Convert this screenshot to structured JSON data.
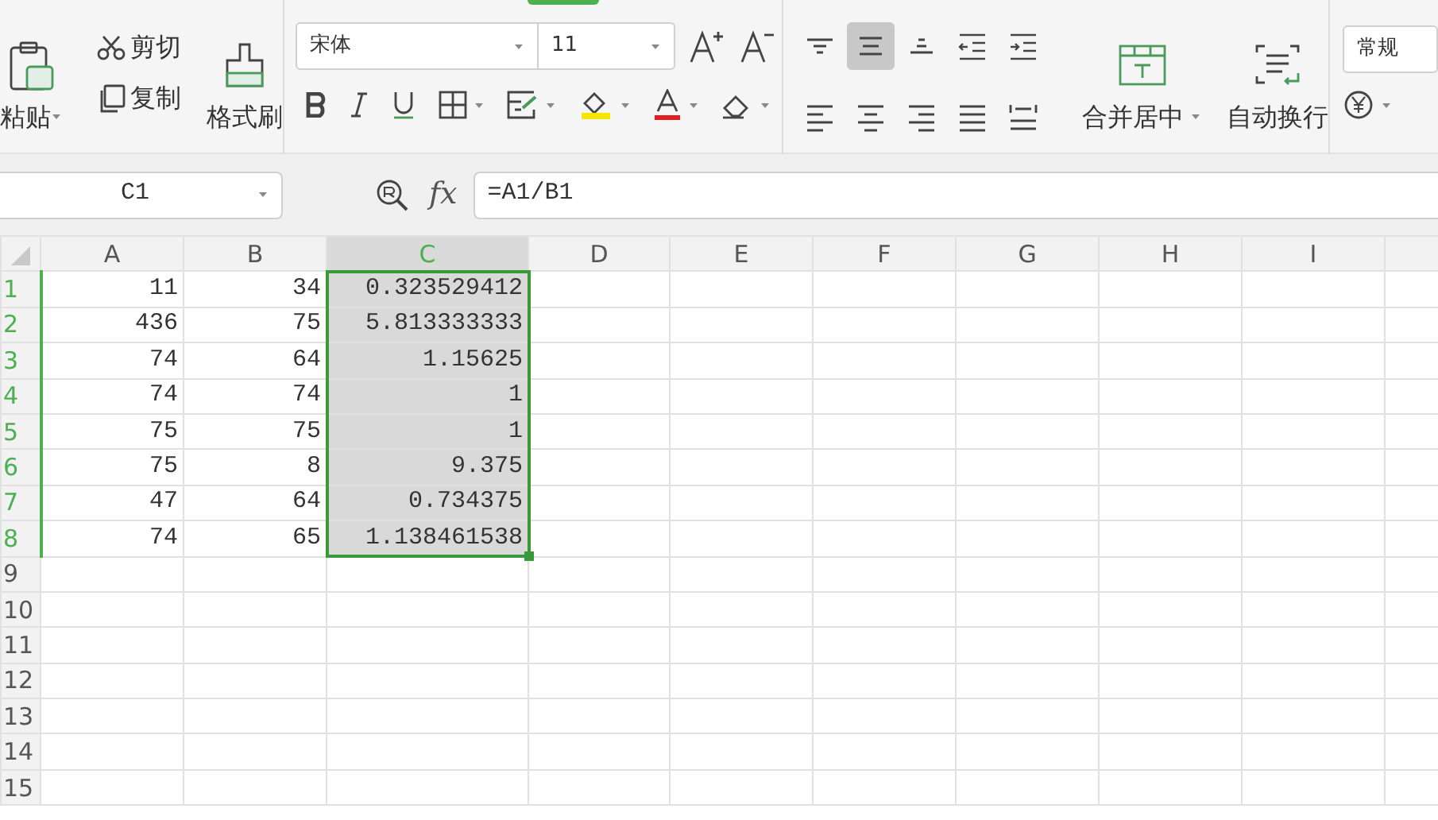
{
  "ribbon": {
    "clipboard": {
      "paste": "粘贴",
      "cut": "剪切",
      "copy": "复制",
      "format_painter": "格式刷"
    },
    "font": {
      "name": "宋体",
      "size": "11"
    },
    "align_buttons": [
      {
        "kind": "top",
        "selected": false
      },
      {
        "kind": "middle",
        "selected": true
      },
      {
        "kind": "bottom",
        "selected": false
      },
      {
        "kind": "outdent",
        "selected": false
      },
      {
        "kind": "indent",
        "selected": false
      },
      {
        "kind": "left",
        "selected": false
      },
      {
        "kind": "center",
        "selected": false
      },
      {
        "kind": "right",
        "selected": false
      },
      {
        "kind": "justify",
        "selected": false
      },
      {
        "kind": "distribute",
        "selected": false
      }
    ],
    "merge": "合并居中",
    "wrap": "自动换行",
    "number_format": "常规"
  },
  "formula_bar": {
    "cell_ref": "C1",
    "fx": "fx",
    "formula": "=A1/B1"
  },
  "sheet": {
    "columns": [
      {
        "label": "A",
        "selected": false
      },
      {
        "label": "B",
        "selected": false
      },
      {
        "label": "C",
        "selected": true
      },
      {
        "label": "D",
        "selected": false
      },
      {
        "label": "E",
        "selected": false
      },
      {
        "label": "F",
        "selected": false
      },
      {
        "label": "G",
        "selected": false
      },
      {
        "label": "H",
        "selected": false
      },
      {
        "label": "I",
        "selected": false
      }
    ],
    "rows": [
      {
        "label": "1",
        "selected": true,
        "cells": [
          "11",
          "34",
          "0.323529412"
        ]
      },
      {
        "label": "2",
        "selected": true,
        "cells": [
          "436",
          "75",
          "5.813333333"
        ]
      },
      {
        "label": "3",
        "selected": true,
        "cells": [
          "74",
          "64",
          "1.15625"
        ]
      },
      {
        "label": "4",
        "selected": true,
        "cells": [
          "74",
          "74",
          "1"
        ]
      },
      {
        "label": "5",
        "selected": true,
        "cells": [
          "75",
          "75",
          "1"
        ]
      },
      {
        "label": "6",
        "selected": true,
        "cells": [
          "75",
          "8",
          "9.375"
        ]
      },
      {
        "label": "7",
        "selected": true,
        "cells": [
          "47",
          "64",
          "0.734375"
        ]
      },
      {
        "label": "8",
        "selected": true,
        "cells": [
          "74",
          "65",
          "1.138461538"
        ]
      },
      {
        "label": "9",
        "selected": false,
        "cells": []
      },
      {
        "label": "10",
        "selected": false,
        "cells": []
      },
      {
        "label": "11",
        "selected": false,
        "cells": []
      },
      {
        "label": "12",
        "selected": false,
        "cells": []
      },
      {
        "label": "13",
        "selected": false,
        "cells": []
      },
      {
        "label": "14",
        "selected": false,
        "cells": []
      },
      {
        "label": "15",
        "selected": false,
        "cells": []
      }
    ]
  }
}
